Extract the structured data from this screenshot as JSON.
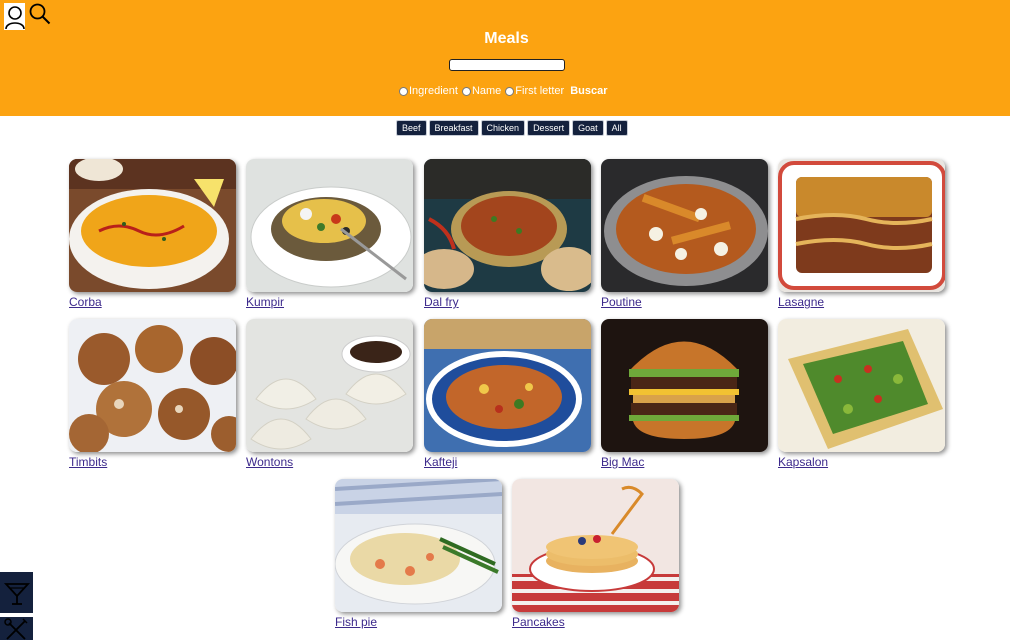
{
  "header": {
    "title": "Meals",
    "profile_icon": "user-icon",
    "search_icon": "search-icon",
    "search_input": {
      "value": "",
      "placeholder": ""
    },
    "radios": [
      {
        "label": "Ingredient",
        "checked": false
      },
      {
        "label": "Name",
        "checked": false
      },
      {
        "label": "First letter",
        "checked": false
      }
    ],
    "submit_label": "Buscar"
  },
  "filters": [
    "Beef",
    "Breakfast",
    "Chicken",
    "Dessert",
    "Goat",
    "All"
  ],
  "meals": [
    {
      "name": "Corba"
    },
    {
      "name": "Kumpir"
    },
    {
      "name": "Dal fry"
    },
    {
      "name": "Poutine"
    },
    {
      "name": "Lasagne"
    },
    {
      "name": "Timbits"
    },
    {
      "name": "Wontons"
    },
    {
      "name": "Kafteji"
    },
    {
      "name": "Big Mac"
    },
    {
      "name": "Kapsalon"
    },
    {
      "name": "Fish pie"
    },
    {
      "name": "Pancakes"
    }
  ],
  "side_nav": [
    {
      "icon": "cocktail-icon"
    },
    {
      "icon": "utensils-icon"
    }
  ],
  "colors": {
    "header": "#fca311",
    "filter_bg": "#14213d",
    "link": "#3d2a8c"
  }
}
